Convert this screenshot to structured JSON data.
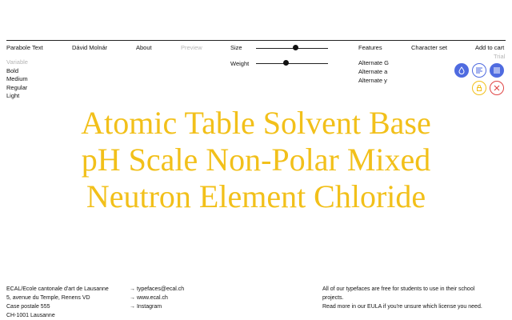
{
  "nav": {
    "font_name": "Parabole Text",
    "designer": "Dávid Molnár",
    "about": "About",
    "preview": "Preview",
    "size_label": "Size",
    "features": "Features",
    "character_set": "Character set",
    "add_to_cart": "Add to cart",
    "trial": "Trial"
  },
  "controls": {
    "weight_label": "Weight",
    "size_level": 0.55,
    "weight_level": 0.42
  },
  "weights": {
    "heading": "Variable",
    "items": [
      "Bold",
      "Medium",
      "Regular",
      "Light"
    ]
  },
  "features": [
    "Alternate G",
    "Alternate a",
    "Alternate y"
  ],
  "icons": {
    "ink": "ink-drop-icon",
    "align_left": "align-left-icon",
    "align_justify": "align-justify-icon",
    "lock": "lock-icon",
    "close": "close-icon"
  },
  "colors": {
    "preview": "#f2c01a",
    "accent_blue": "#4f6be0",
    "close_red": "#e04545"
  },
  "preview_lines": [
    "Atomic Table Solvent Base",
    "pH Scale Non-Polar Mixed",
    "Neutron Element Chloride"
  ],
  "footer": {
    "address": [
      "ECAL/Ecole cantonale d'art de Lausanne",
      "5, avenue du Temple, Renens VD",
      "Case postale 555",
      "CH-1001 Lausanne"
    ],
    "links": [
      "→ typefaces@ecal.ch",
      "→ www.ecal.ch",
      "→ Instagram"
    ],
    "license": [
      "All of our typefaces are free for students to use in their school",
      "projects.",
      "Read more in our EULA if you're unsure which license you need."
    ]
  }
}
